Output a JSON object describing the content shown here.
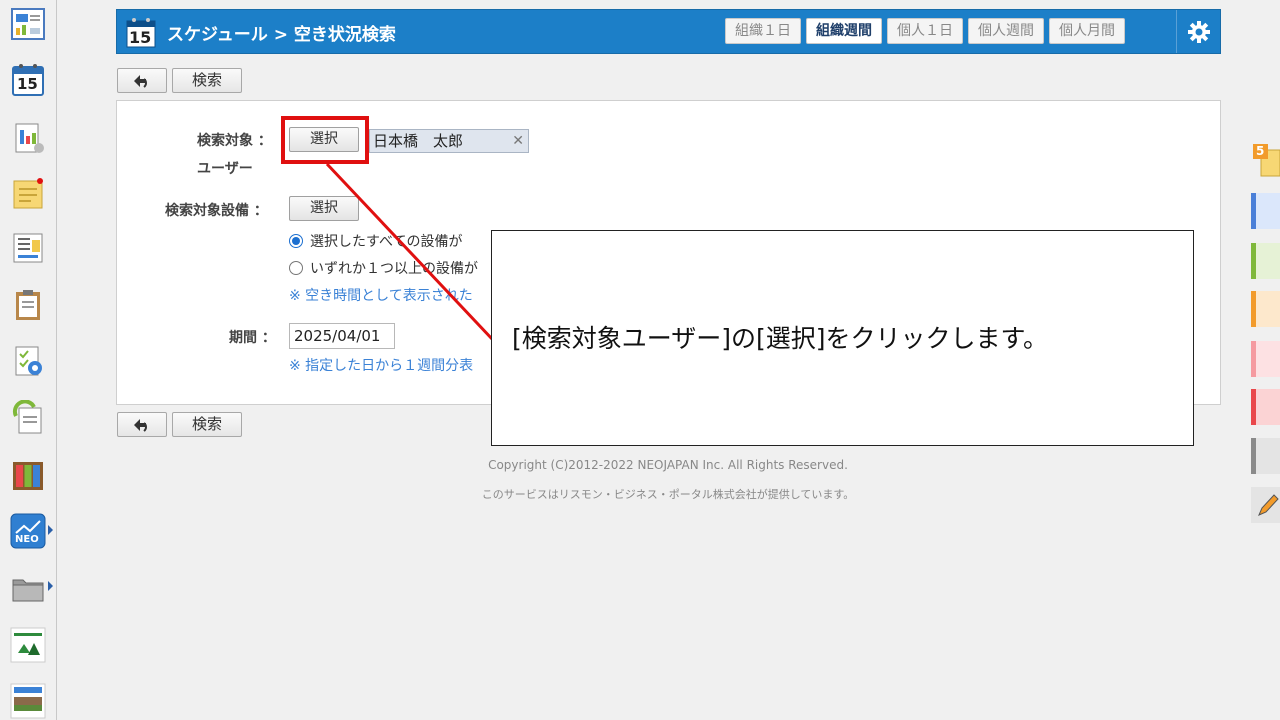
{
  "header": {
    "calendar_day": "15",
    "title": "スケジュール > 空き状況検索",
    "tabs": [
      {
        "label": "組織１日",
        "active": false
      },
      {
        "label": "組織週間",
        "active": true
      },
      {
        "label": "個人１日",
        "active": false
      },
      {
        "label": "個人週間",
        "active": false
      },
      {
        "label": "個人月間",
        "active": false
      }
    ]
  },
  "sidebar": {
    "calendar_day": "15",
    "neo_label": "NEO"
  },
  "toolbar": {
    "search_label": "検索"
  },
  "form": {
    "target_user_label": "検索対象",
    "target_user_label_2": "ユーザー",
    "colon": "：",
    "select_label": "選択",
    "selected_user": "日本橋　太郎",
    "remove_glyph": "✕",
    "target_facility_label": "検索対象設備",
    "radio_all": "選択したすべての設備が",
    "radio_any": "いずれか１つ以上の設備が",
    "facility_note": "※ 空き時間として表示された",
    "period_label": "期間",
    "period_value": "2025/04/01",
    "period_note": "※ 指定した日から１週間分表"
  },
  "callout": {
    "text": "[検索対象ユーザー]の[選択]をクリックします。"
  },
  "footer": {
    "copyright": "Copyright (C)2012-2022 NEOJAPAN Inc. All Rights Reserved.",
    "provider": "このサービスはリスモン・ビジネス・ポータル株式会社が提供しています。"
  },
  "right_rail": {
    "badge": "5",
    "colors": [
      "#4a7fd8",
      "#7fb83a",
      "#f29b2b",
      "#f59aa0",
      "#e9474b",
      "#8a8a8a"
    ]
  }
}
